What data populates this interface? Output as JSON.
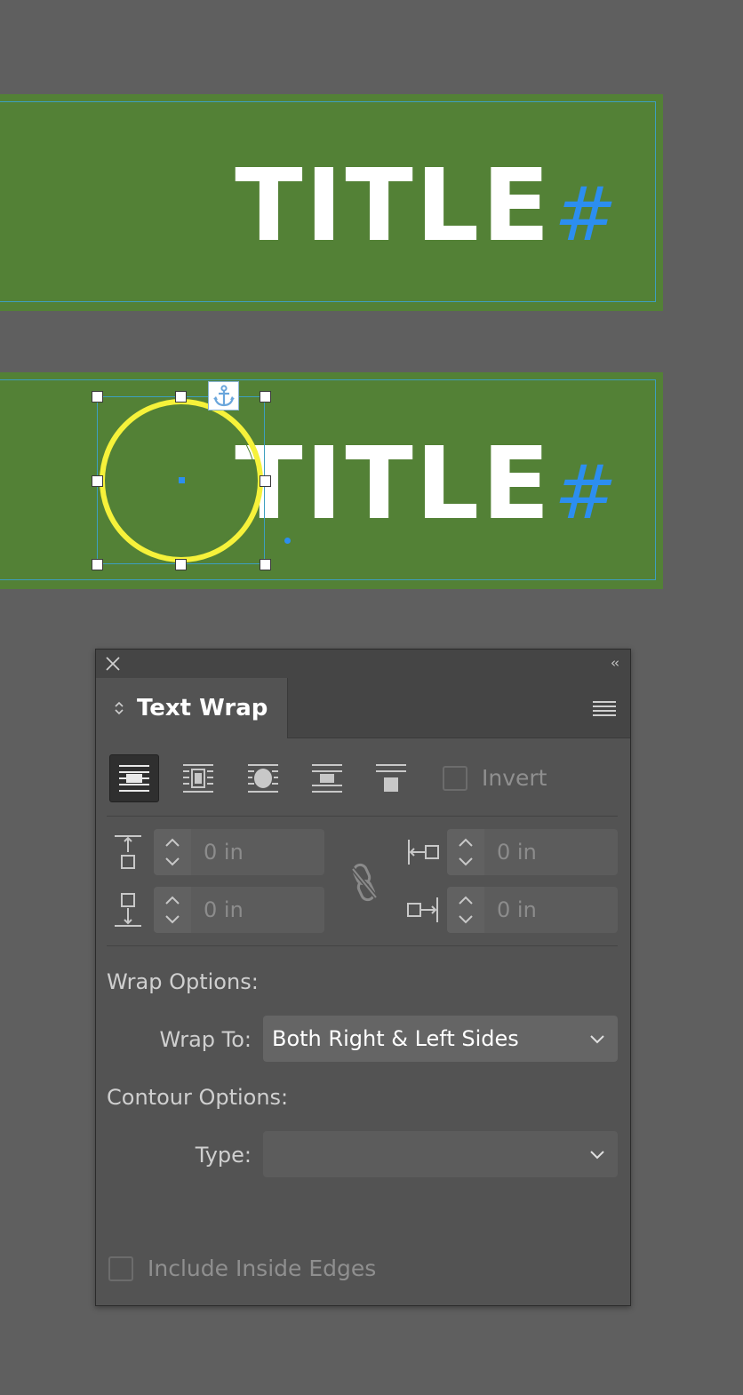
{
  "canvas": {
    "frame1": {
      "title": "TITLE",
      "marker": "#"
    },
    "frame2": {
      "title": "TITLE",
      "marker": "#",
      "anchor_icon": "anchor-icon"
    }
  },
  "panel": {
    "tab_label": "Text Wrap",
    "wrap_modes": [
      "no-text-wrap-icon",
      "wrap-around-bounding-box-icon",
      "wrap-around-object-shape-icon",
      "jump-object-icon",
      "jump-to-next-column-icon"
    ],
    "active_mode": 0,
    "invert_label": "Invert",
    "offsets": {
      "top": "0 in",
      "bottom": "0 in",
      "left": "0 in",
      "right": "0 in"
    },
    "wrap_options_label": "Wrap Options:",
    "wrap_to_label": "Wrap To:",
    "wrap_to_value": "Both Right & Left Sides",
    "contour_options_label": "Contour Options:",
    "type_label": "Type:",
    "type_value": "",
    "include_inside_edges_label": "Include Inside Edges"
  },
  "colors": {
    "frame_fill": "#538136",
    "selection_stroke": "#f6f23a",
    "marker": "#2c8ef0",
    "panel_bg": "#535353",
    "app_bg": "#5f5f5f"
  }
}
